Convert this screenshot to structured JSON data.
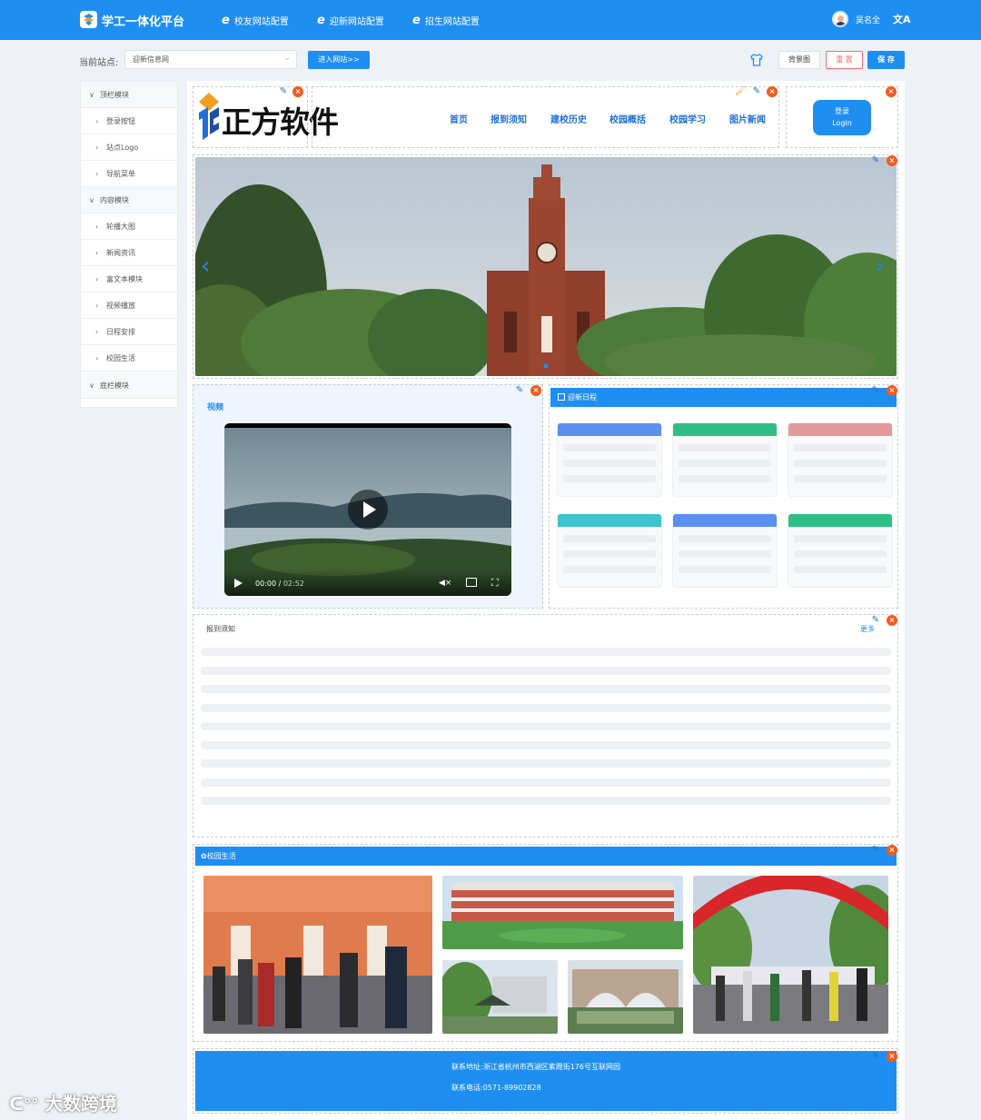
{
  "header": {
    "app_title": "学工一体化平台",
    "nav": [
      "校友网站配置",
      "迎新网站配置",
      "招生网站配置"
    ],
    "nav_icon": "ie-icon",
    "user_name": "吴名全",
    "lang_icon": "translate-icon"
  },
  "toolbar": {
    "site_label": "当前站点:",
    "site_value": "迎新信息网",
    "enter_label": "进入网站>>",
    "background_label": "背景图",
    "reset_label": "重 置",
    "save_label": "保 存"
  },
  "sidebar": {
    "groups": [
      {
        "label": "顶栏模块",
        "items": [
          "登录按钮",
          "站点Logo",
          "导航菜单"
        ]
      },
      {
        "label": "内容模块",
        "items": [
          "轮播大图",
          "新闻资讯",
          "富文本模块",
          "视频播放",
          "日程安排",
          "校园生活"
        ]
      },
      {
        "label": "底栏模块",
        "items": []
      }
    ]
  },
  "top_module": {
    "logo_text": "正方软件",
    "menu": [
      "首页",
      "报到须知",
      "建校历史",
      "校园概括",
      "校园学习",
      "图片新闻"
    ],
    "login_label": "登录",
    "login_sub": "Login"
  },
  "video_module": {
    "title": "视频",
    "time_current": "00:00",
    "time_total": "02:52"
  },
  "schedule_module": {
    "title": "迎新日程",
    "card_colors": [
      "#5b8ff0",
      "#2fbf86",
      "#e49a9a",
      "#3ec2d0",
      "#5b8ff0",
      "#2fbf86"
    ]
  },
  "notice_module": {
    "title": "报到须知",
    "more_label": "更多"
  },
  "life_module": {
    "title": "校园生活"
  },
  "footer": {
    "address_label": "联系地址:",
    "address": "浙江省杭州市西湖区紫霞街176号互联网园",
    "phone_label": "联系电话:",
    "phone": "0571-89902828"
  },
  "watermark": "大数跨境",
  "colors": {
    "primary": "#1f8ef1",
    "danger": "#f56c6c",
    "close": "#f25b1d"
  }
}
